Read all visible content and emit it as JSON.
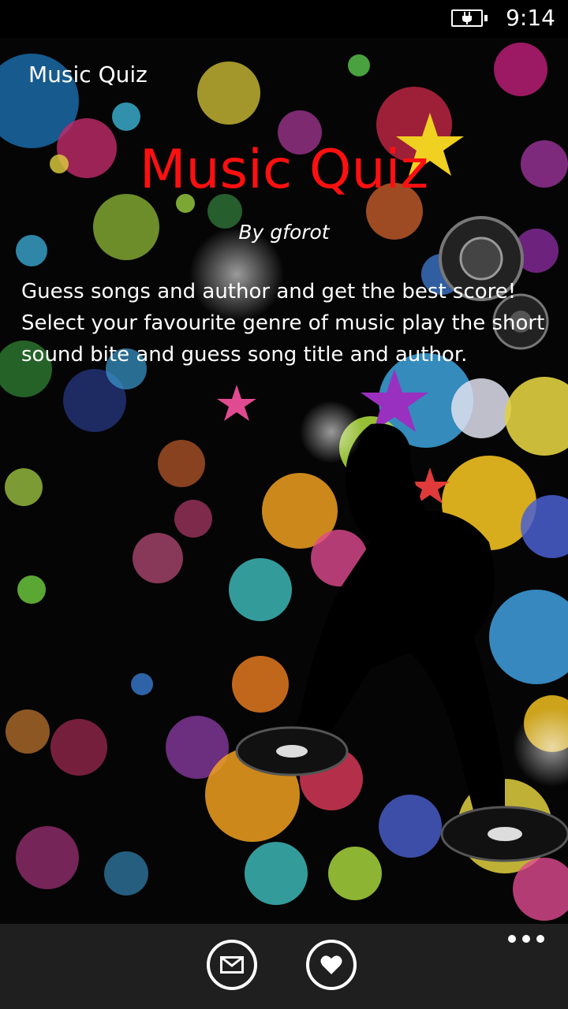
{
  "status_bar": {
    "time": "9:14",
    "battery_icon": "battery-charging-icon"
  },
  "header": {
    "app_title": "Music Quiz"
  },
  "main": {
    "title": "Music Quiz",
    "title_color": "#ff1010",
    "author": "By gforot",
    "description": "Guess songs and author and get the best score! Select your favourite genre of music play the short sound bite and guess song title and author."
  },
  "app_bar": {
    "buttons": [
      {
        "icon": "mail-icon"
      },
      {
        "icon": "heart-icon"
      }
    ],
    "more_icon": "more-ellipsis-icon"
  }
}
